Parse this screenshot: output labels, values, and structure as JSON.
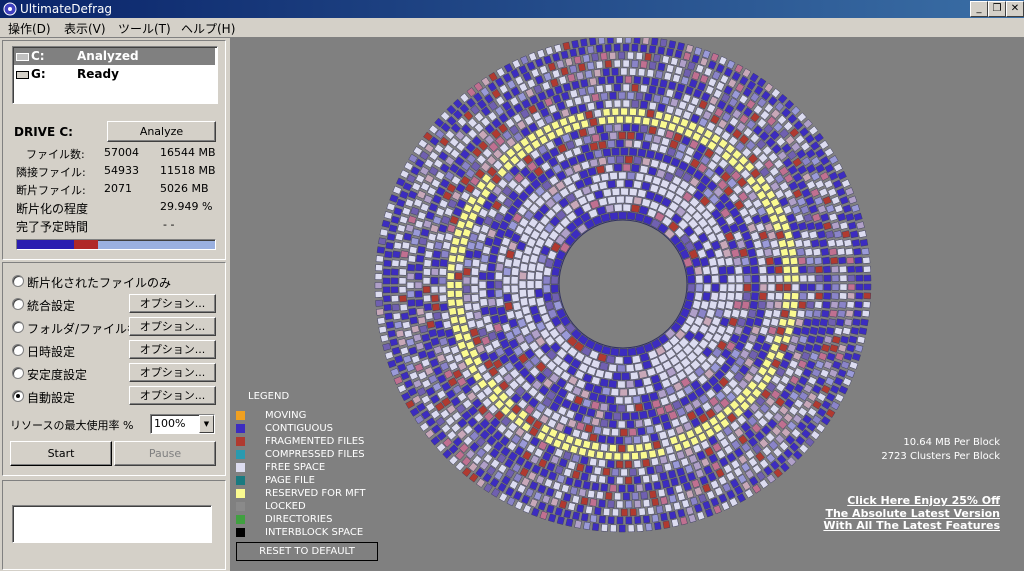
{
  "window": {
    "title": "UltimateDefrag"
  },
  "menu": [
    {
      "label": "操作(D)"
    },
    {
      "label": "表示(V)"
    },
    {
      "label": "ツール(T)"
    },
    {
      "label": "ヘルプ(H)"
    }
  ],
  "drives": [
    {
      "letter": "C:",
      "status": "Analyzed",
      "selected": true
    },
    {
      "letter": "G:",
      "status": "Ready",
      "selected": false
    }
  ],
  "drive_info": {
    "heading": "DRIVE C:",
    "analyze_button": "Analyze",
    "rows": [
      {
        "label": "ファイル数:",
        "count": "57004",
        "size": "16544 MB"
      },
      {
        "label": "隣接ファイル:",
        "count": "54933",
        "size": "11518 MB"
      },
      {
        "label": "断片ファイル:",
        "count": "2071",
        "size": "5026 MB"
      }
    ],
    "frag_label": "断片化の程度",
    "frag_value": "29.949 %",
    "eta_label": "完了予定時間",
    "eta_value": "- -",
    "bar": {
      "contiguous_fraction": 0.29,
      "fragmented_fraction": 0.12,
      "free_fraction": 0.59
    }
  },
  "options": {
    "radios": [
      {
        "label": "断片化されたファイルのみ",
        "checked": false,
        "has_button": false
      },
      {
        "label": "統合設定",
        "checked": false,
        "has_button": true
      },
      {
        "label": "フォルダ/ファイル名",
        "checked": false,
        "has_button": true
      },
      {
        "label": "日時設定",
        "checked": false,
        "has_button": true
      },
      {
        "label": "安定度設定",
        "checked": false,
        "has_button": true
      },
      {
        "label": "自動設定",
        "checked": true,
        "has_button": true
      }
    ],
    "option_button_label": "オプション...",
    "resource_label": "リソースの最大使用率 %",
    "resource_value": "100%",
    "start_button": "Start",
    "pause_button": "Pause"
  },
  "legend": {
    "title": "LEGEND",
    "items": [
      {
        "label": "MOVING",
        "color": "#f0a020"
      },
      {
        "label": "CONTIGUOUS",
        "color": "#3c2cc0"
      },
      {
        "label": "FRAGMENTED FILES",
        "color": "#b03a30"
      },
      {
        "label": "COMPRESSED FILES",
        "color": "#2a9ab0"
      },
      {
        "label": "FREE SPACE",
        "color": "#dcdcf0"
      },
      {
        "label": "PAGE FILE",
        "color": "#1a7a80"
      },
      {
        "label": "RESERVED FOR MFT",
        "color": "#fafa90"
      },
      {
        "label": "LOCKED",
        "color": "#8a8a8a"
      },
      {
        "label": "DIRECTORIES",
        "color": "#40a040"
      },
      {
        "label": "INTERBLOCK SPACE",
        "color": "#000000"
      }
    ],
    "reset_button": "RESET TO DEFAULT"
  },
  "stats": {
    "per_block": "10.64 MB Per Block",
    "clusters": "2723 Clusters Per Block"
  },
  "promo": {
    "line1": "Click Here Enjoy 25% Off",
    "line2": "The Absolute Latest Version",
    "line3": "With All The Latest Features"
  }
}
